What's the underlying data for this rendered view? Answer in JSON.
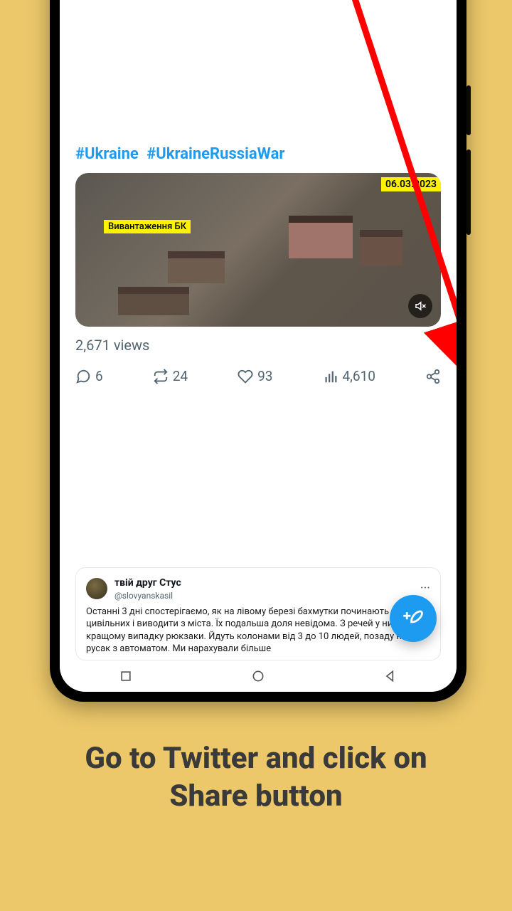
{
  "tweet": {
    "hashtags": [
      "#Ukraine",
      "#UkraineRussiaWar"
    ],
    "video": {
      "date_badge": "06.03.2023",
      "caption_badge": "Вивантаження БК"
    },
    "views_text": "2,671 views",
    "actions": {
      "reply_count": "6",
      "retweet_count": "24",
      "like_count": "93",
      "analytics_count": "4,610"
    }
  },
  "next_tweet": {
    "display_name": "твій друг Стус",
    "handle": "@slovyanskasil",
    "body": "Останні 3 дні спостерігаємо, як на лівому березі бахмутки починають збирати цивільних і виводити з міста. Їх подальша доля невідома. З речей у них в кращому випадку рюкзаки. Йдуть колонами від 3 до 10 людей, позаду них русак з автоматом. Ми нарахували більше",
    "more": "···"
  },
  "instruction": "Go to Twitter and click on Share button"
}
